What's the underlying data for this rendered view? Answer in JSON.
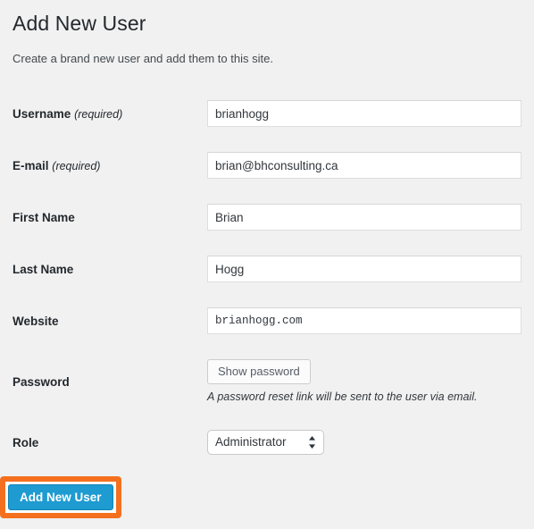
{
  "header": {
    "title": "Add New User",
    "subtitle": "Create a brand new user and add them to this site."
  },
  "form": {
    "username": {
      "label": "Username",
      "required_note": "(required)",
      "value": "brianhogg",
      "placeholder": ""
    },
    "email": {
      "label": "E-mail",
      "required_note": "(required)",
      "value": "brian@bhconsulting.ca",
      "placeholder": ""
    },
    "first_name": {
      "label": "First Name",
      "value": "Brian",
      "placeholder": ""
    },
    "last_name": {
      "label": "Last Name",
      "value": "Hogg",
      "placeholder": ""
    },
    "website": {
      "label": "Website",
      "value": "brianhogg.com",
      "placeholder": ""
    },
    "password": {
      "label": "Password",
      "show_password_label": "Show password",
      "description": "A password reset link will be sent to the user via email."
    },
    "role": {
      "label": "Role",
      "selected": "Administrator",
      "options": [
        "Administrator"
      ]
    }
  },
  "submit": {
    "label": "Add New User"
  },
  "icons": {
    "stepper": "up-down-stepper-icon"
  },
  "colors": {
    "page_background": "#f1f1f1",
    "primary_button": "#1e9bd1",
    "primary_button_border": "#1183b5",
    "highlight_border": "#f4701f",
    "input_border": "#dedede",
    "heading_text": "#23282d"
  }
}
